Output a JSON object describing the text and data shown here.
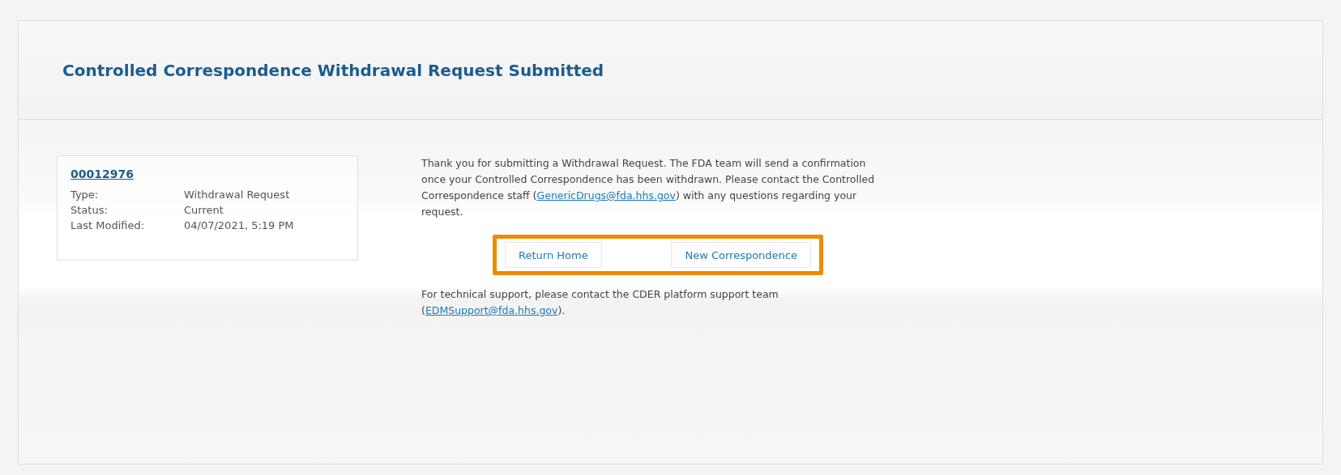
{
  "header": {
    "title": "Controlled Correspondence Withdrawal Request Submitted"
  },
  "record": {
    "number": "00012976",
    "fields": [
      {
        "label": "Type:",
        "value": "Withdrawal Request"
      },
      {
        "label": "Status:",
        "value": "Current"
      },
      {
        "label": "Last Modified:",
        "value": "04/07/2021, 5:19 PM"
      }
    ]
  },
  "message": {
    "before": "Thank you for submitting a Withdrawal Request. The FDA team will send a confirmation once your Controlled Correspondence has been withdrawn. Please contact the Controlled Correspondence staff (",
    "link": "GenericDrugs@fda.hhs.gov",
    "after": ") with any questions regarding your request."
  },
  "buttons": [
    "Return Home",
    "New Correspondence"
  ],
  "support": {
    "before": "For technical support, please contact the CDER platform support team (",
    "link": "EDMSupport@fda.hhs.gov",
    "after": ")."
  }
}
